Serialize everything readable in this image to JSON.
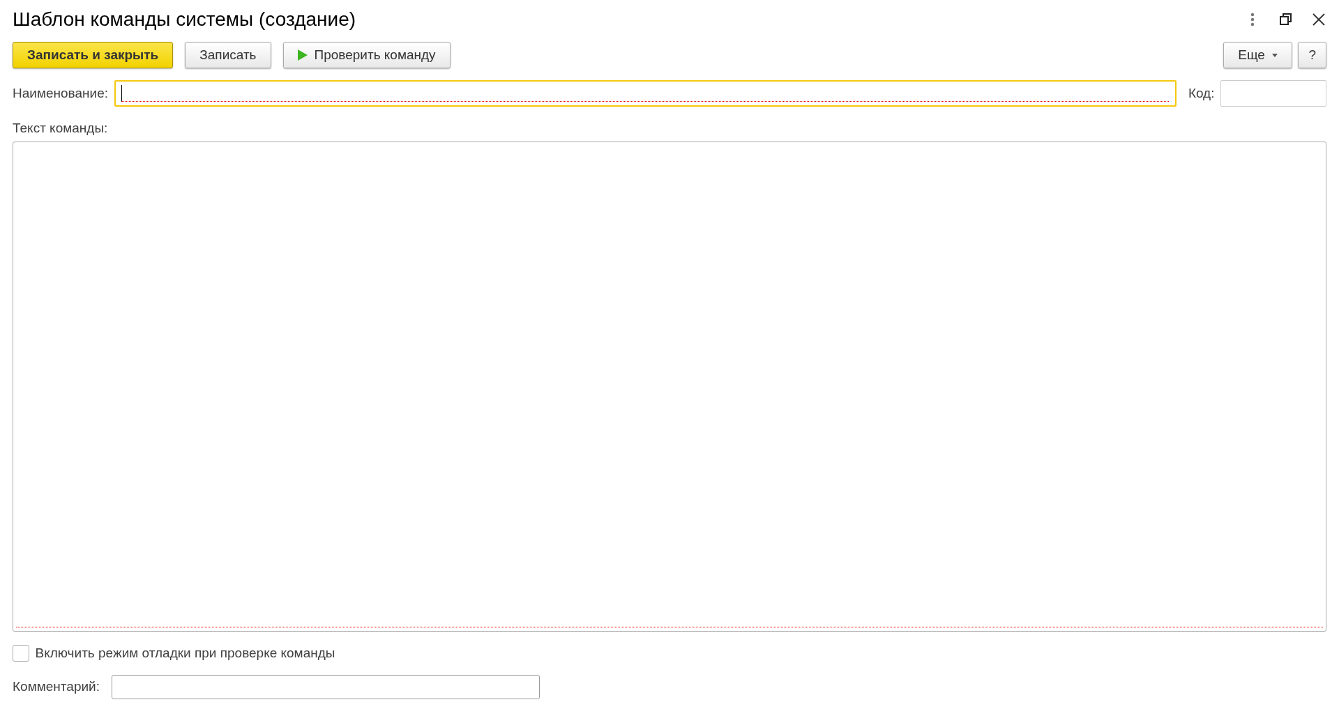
{
  "window": {
    "title": "Шаблон команды системы (создание)"
  },
  "toolbar": {
    "buttons": [
      {
        "label": "Записать и закрыть",
        "kind": "primary"
      },
      {
        "label": "Записать",
        "kind": "plain"
      },
      {
        "label": "Проверить команду",
        "kind": "run"
      }
    ],
    "right_buttons": [
      {
        "label": "Еще",
        "kind": "dropdown"
      },
      {
        "label": "?",
        "kind": "plain"
      }
    ]
  },
  "name_field": {
    "label": "Наименование:",
    "focused": true,
    "required": true
  },
  "code_field": {
    "label": "Код:"
  },
  "command_text": {
    "label": "Текст команды:",
    "required": true
  },
  "debug_checkbox": {
    "label": "Включить режим отладки при проверке команды",
    "checked": false
  },
  "comment_field": {
    "label": "Комментарий:"
  }
}
